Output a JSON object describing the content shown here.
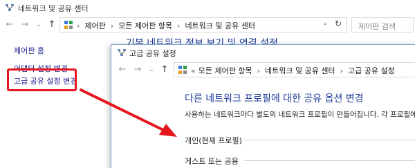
{
  "back_window": {
    "title": "네트워크 및 공유 센터",
    "nav": {
      "back": "←",
      "forward": "→",
      "dropdown": "⌄",
      "up": "↑"
    },
    "address": {
      "crumbs": [
        "제어판",
        "모든 제어판 항목",
        "네트워크 및 공유 센터"
      ],
      "separator": "›",
      "dropdown": "⌄",
      "refresh": "↻"
    },
    "search_placeholder": "제어판 검색",
    "sidebar": {
      "items": [
        "제어판 홈",
        "어댑터 설정 변경",
        "고급 공유 설정 변경"
      ]
    },
    "heading": "기본 네트워크 정보 보기 및 연결 설정"
  },
  "front_window": {
    "title": "고급 공유 설정",
    "nav": {
      "back": "←",
      "forward": "→",
      "dropdown": "⌄",
      "up": "↑"
    },
    "address": {
      "prefix": "«",
      "crumbs": [
        "모든 제어판 항목",
        "네트워크 및 공유 센터",
        "고급 공유 설정"
      ],
      "separator": "›"
    },
    "heading": "다른 네트워크 프로필에 대한 공유 옵션 변경",
    "description": "사용하는 네트워크마다 별도의 네트워크 프로필이 만들어집니다. 각 프로필에",
    "sections": [
      "개인(현재 프로필)",
      "게스트 또는 공용"
    ]
  },
  "colors": {
    "highlight": "#e4161e",
    "link": "#1a1a8c",
    "heading": "#1c3a96",
    "arrow": "#e4161e"
  }
}
